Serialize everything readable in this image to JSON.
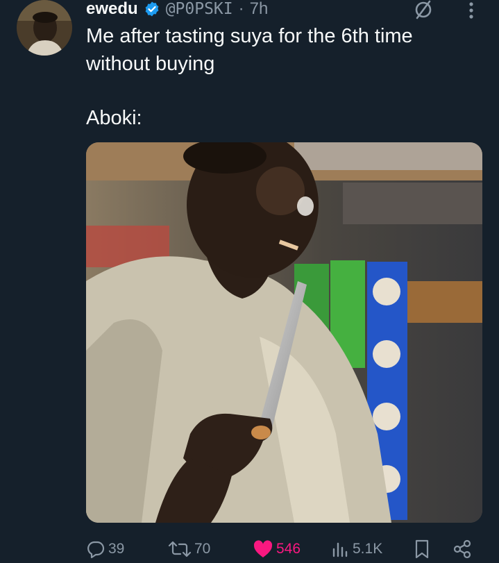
{
  "tweet": {
    "author": {
      "display_name": "ewedu",
      "handle": "@P0PSKI",
      "separator": "·",
      "time": "7h",
      "verified": true,
      "avatar_icon": "profile-photo"
    },
    "text_lines": [
      "Me after tasting suya for the 6th time",
      "without buying",
      "Aboki:"
    ],
    "media": {
      "type": "photo",
      "icon": "photo-vendor-with-knife"
    },
    "actions": {
      "replies": "39",
      "retweets": "70",
      "likes": "546",
      "views": "5.1K"
    }
  },
  "colors": {
    "background": "#15202b",
    "text": "#e7e9ea",
    "secondary": "#8b98a5",
    "like": "#f91880",
    "verified": "#1d9bf0"
  },
  "icons": {
    "grok": "grok-icon",
    "more": "more-vertical-icon",
    "reply": "reply-icon",
    "retweet": "retweet-icon",
    "like": "heart-filled-icon",
    "views": "analytics-icon",
    "bookmark": "bookmark-icon",
    "share": "share-icon"
  }
}
